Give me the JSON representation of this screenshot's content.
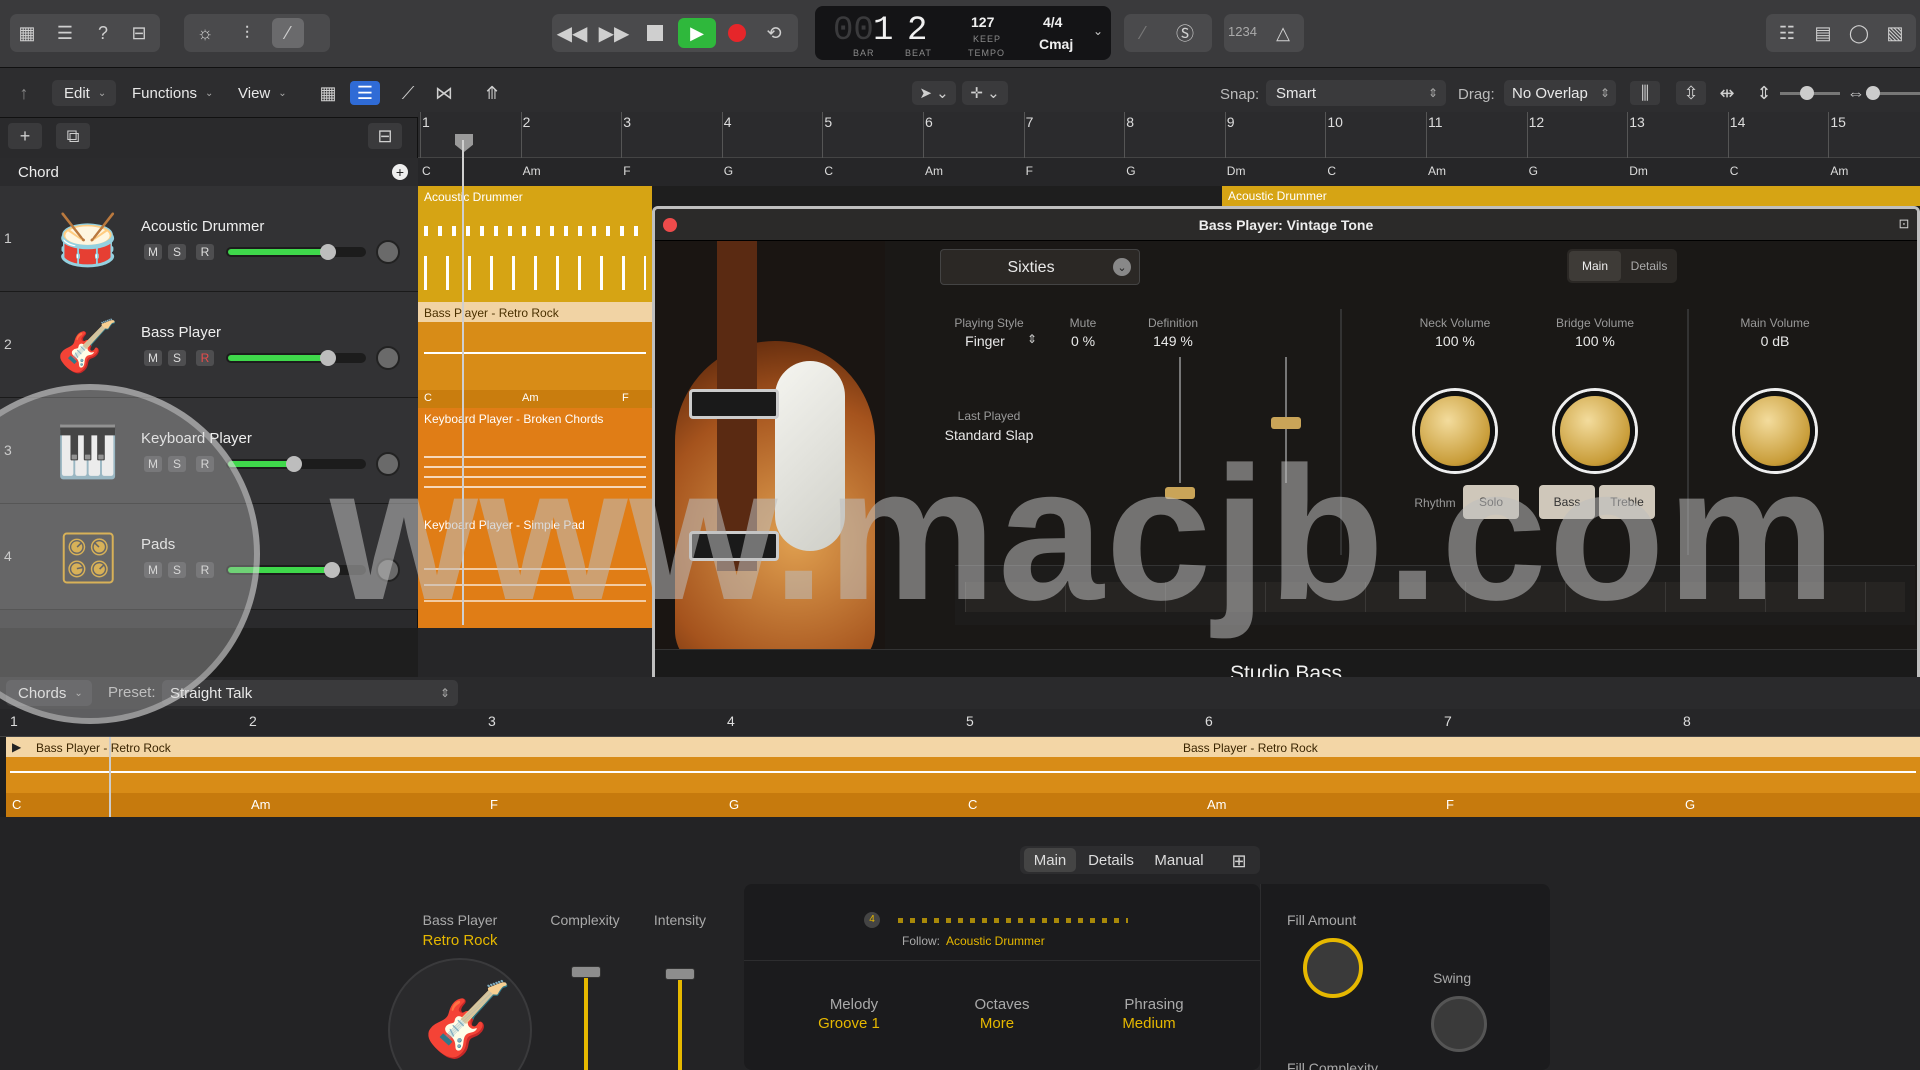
{
  "control_bar": {
    "lcd": {
      "bar_prefix": "00",
      "bar": "1",
      "beat": "2",
      "bar_label": "BAR",
      "beat_label": "BEAT",
      "tempo": "127",
      "keep": "KEEP",
      "tempo_label": "TEMPO",
      "signature": "4/4",
      "key": "Cmaj"
    },
    "count_in": "1234"
  },
  "menu": {
    "edit": "Edit",
    "functions": "Functions",
    "view": "View",
    "snap_label": "Snap:",
    "snap_value": "Smart",
    "drag_label": "Drag:",
    "drag_value": "No Overlap"
  },
  "ruler_bars": [
    "1",
    "2",
    "3",
    "4",
    "5",
    "6",
    "7",
    "8",
    "9",
    "10",
    "11",
    "12",
    "13",
    "14",
    "15"
  ],
  "chord_lane": {
    "label": "Chord",
    "chords": [
      "C",
      "Am",
      "F",
      "G",
      "C",
      "Am",
      "F",
      "G",
      "Dm",
      "C",
      "Am",
      "G",
      "Dm",
      "C",
      "Am"
    ]
  },
  "tracks": [
    {
      "num": "1",
      "name": "Acoustic Drummer",
      "m": "M",
      "s": "S",
      "r": "R",
      "level": 0.75
    },
    {
      "num": "2",
      "name": "Bass Player",
      "m": "M",
      "s": "S",
      "r": "R",
      "level": 0.75
    },
    {
      "num": "3",
      "name": "Keyboard Player",
      "m": "M",
      "s": "S",
      "r": "R",
      "level": 0.5
    },
    {
      "num": "4",
      "name": "Pads",
      "m": "M",
      "s": "S",
      "r": "R",
      "level": 0.78
    }
  ],
  "regions": {
    "drummer": "Acoustic Drummer",
    "drummer2": "Acoustic Drummer",
    "bass": "Bass Player - Retro Rock",
    "bass_chords": [
      "C",
      "Am",
      "F"
    ],
    "keys": "Keyboard Player - Broken Chords",
    "pads": "Keyboard Player - Simple Pad"
  },
  "plugin": {
    "title": "Bass Player: Vintage Tone",
    "preset": "Sixties",
    "tab_main": "Main",
    "tab_details": "Details",
    "playing_style_label": "Playing Style",
    "playing_style_value": "Finger",
    "mute_label": "Mute",
    "mute_value": "0 %",
    "definition_label": "Definition",
    "definition_value": "149 %",
    "last_played_label": "Last Played",
    "last_played_value": "Standard Slap",
    "neck_label": "Neck Volume",
    "neck_value": "100 %",
    "bridge_label": "Bridge Volume",
    "bridge_value": "100 %",
    "main_vol_label": "Main Volume",
    "main_vol_value": "0 dB",
    "rhythm": "Rhythm",
    "solo": "Solo",
    "bass": "Bass",
    "treble": "Treble",
    "footer": "Studio Bass"
  },
  "watermark": "www.macjb.com",
  "editor": {
    "chords_menu": "Chords",
    "preset_label": "Preset:",
    "preset_value": "Straight Talk",
    "bars": [
      "1",
      "2",
      "3",
      "4",
      "5",
      "6",
      "7",
      "8"
    ],
    "region_name": "Bass Player - Retro Rock",
    "region_name2": "Bass Player - Retro Rock",
    "region_chords": [
      "C",
      "Am",
      "F",
      "G",
      "C",
      "Am",
      "F",
      "G"
    ],
    "tab_main": "Main",
    "tab_details": "Details",
    "tab_manual": "Manual",
    "player_label": "Bass Player",
    "player_value": "Retro Rock",
    "complexity": "Complexity",
    "intensity": "Intensity",
    "pattern_count": "4",
    "follow_label": "Follow:",
    "follow_value": "Acoustic Drummer",
    "melody_label": "Melody",
    "melody_value": "Groove 1",
    "octaves_label": "Octaves",
    "octaves_value": "More",
    "phrasing_label": "Phrasing",
    "phrasing_value": "Medium",
    "fill_amount": "Fill Amount",
    "swing": "Swing",
    "fill_complexity": "Fill Complexity"
  }
}
